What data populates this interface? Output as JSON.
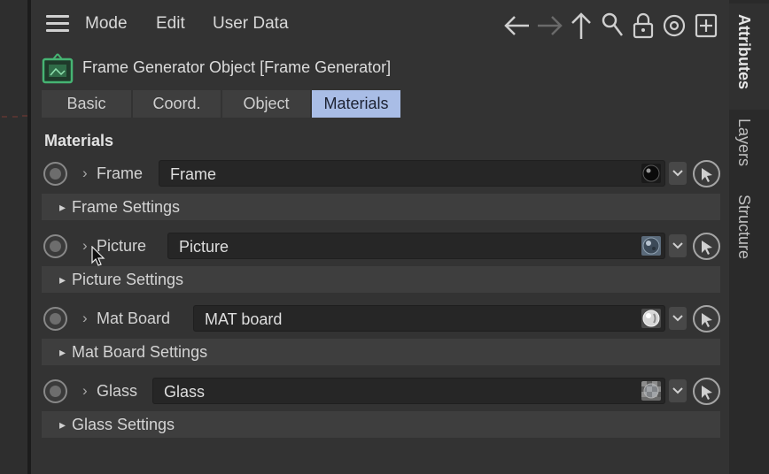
{
  "menubar": {
    "items": [
      "Mode",
      "Edit",
      "User Data"
    ],
    "icons": [
      "back-arrow-icon",
      "forward-arrow-icon",
      "up-arrow-icon",
      "search-icon",
      "lock-icon",
      "target-icon",
      "new-panel-icon"
    ]
  },
  "object": {
    "title": "Frame Generator Object [Frame Generator]",
    "icon": "frame-generator-icon",
    "icon_color": "#46b473"
  },
  "tabs": [
    {
      "label": "Basic",
      "active": false
    },
    {
      "label": "Coord.",
      "active": false
    },
    {
      "label": "Object",
      "active": false
    },
    {
      "label": "Materials",
      "active": true
    }
  ],
  "materials": {
    "section_title": "Materials",
    "rows": [
      {
        "label": "Frame",
        "value": "Frame",
        "settings_label": "Frame Settings",
        "swatch": "black-sphere"
      },
      {
        "label": "Picture",
        "value": "Picture",
        "settings_label": "Picture Settings",
        "swatch": "textured-sphere"
      },
      {
        "label": "Mat Board",
        "value": "MAT board",
        "settings_label": "Mat Board Settings",
        "swatch": "white-sphere"
      },
      {
        "label": "Glass",
        "value": "Glass",
        "settings_label": "Glass Settings",
        "swatch": "checker-sphere"
      }
    ]
  },
  "side_tabs": [
    {
      "label": "Attributes",
      "active": true
    },
    {
      "label": "Layers",
      "active": false
    },
    {
      "label": "Structure",
      "active": false
    }
  ],
  "colors": {
    "active_tab": "#a9bde6",
    "panel_bg": "#333333",
    "field_bg": "#262626"
  }
}
